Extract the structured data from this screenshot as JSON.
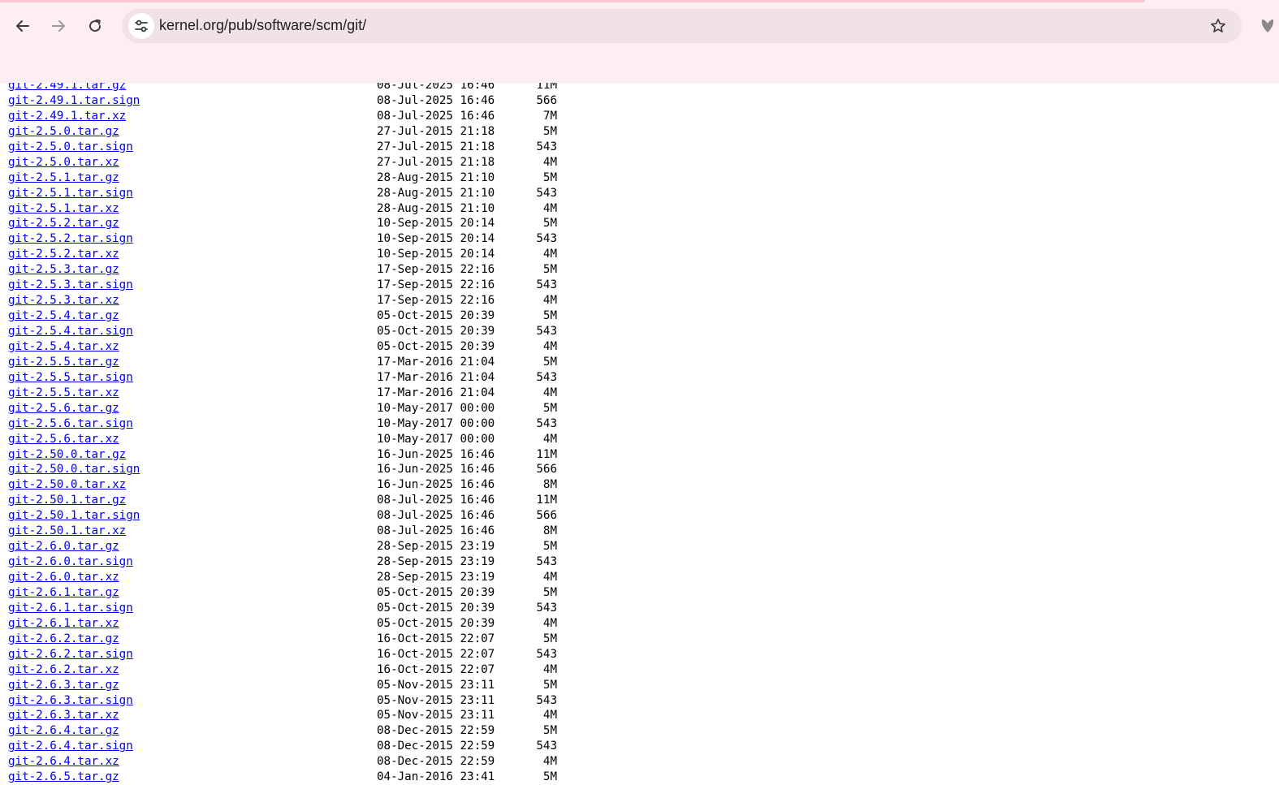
{
  "browser": {
    "url": "kernel.org/pub/software/scm/git/",
    "icons": {
      "back": "back-arrow-icon",
      "forward": "forward-arrow-icon",
      "reload": "reload-icon",
      "site_info": "tune-icon",
      "bookmark": "star-icon",
      "extension": "heart-icon"
    },
    "colors": {
      "toolbar": "#fdeff1",
      "omnibox": "#f1e2e5",
      "accent": "#f6c4cc"
    }
  },
  "listing": {
    "link_color": "#0000ee",
    "rows": [
      {
        "name": "git-2.49.1.tar.gz",
        "date": "08-Jul-2025 16:46",
        "size": "11M"
      },
      {
        "name": "git-2.49.1.tar.sign",
        "date": "08-Jul-2025 16:46",
        "size": "566"
      },
      {
        "name": "git-2.49.1.tar.xz",
        "date": "08-Jul-2025 16:46",
        "size": "7M"
      },
      {
        "name": "git-2.5.0.tar.gz",
        "date": "27-Jul-2015 21:18",
        "size": "5M"
      },
      {
        "name": "git-2.5.0.tar.sign",
        "date": "27-Jul-2015 21:18",
        "size": "543"
      },
      {
        "name": "git-2.5.0.tar.xz",
        "date": "27-Jul-2015 21:18",
        "size": "4M"
      },
      {
        "name": "git-2.5.1.tar.gz",
        "date": "28-Aug-2015 21:10",
        "size": "5M"
      },
      {
        "name": "git-2.5.1.tar.sign",
        "date": "28-Aug-2015 21:10",
        "size": "543"
      },
      {
        "name": "git-2.5.1.tar.xz",
        "date": "28-Aug-2015 21:10",
        "size": "4M"
      },
      {
        "name": "git-2.5.2.tar.gz",
        "date": "10-Sep-2015 20:14",
        "size": "5M"
      },
      {
        "name": "git-2.5.2.tar.sign",
        "date": "10-Sep-2015 20:14",
        "size": "543"
      },
      {
        "name": "git-2.5.2.tar.xz",
        "date": "10-Sep-2015 20:14",
        "size": "4M"
      },
      {
        "name": "git-2.5.3.tar.gz",
        "date": "17-Sep-2015 22:16",
        "size": "5M"
      },
      {
        "name": "git-2.5.3.tar.sign",
        "date": "17-Sep-2015 22:16",
        "size": "543"
      },
      {
        "name": "git-2.5.3.tar.xz",
        "date": "17-Sep-2015 22:16",
        "size": "4M"
      },
      {
        "name": "git-2.5.4.tar.gz",
        "date": "05-Oct-2015 20:39",
        "size": "5M"
      },
      {
        "name": "git-2.5.4.tar.sign",
        "date": "05-Oct-2015 20:39",
        "size": "543"
      },
      {
        "name": "git-2.5.4.tar.xz",
        "date": "05-Oct-2015 20:39",
        "size": "4M"
      },
      {
        "name": "git-2.5.5.tar.gz",
        "date": "17-Mar-2016 21:04",
        "size": "5M"
      },
      {
        "name": "git-2.5.5.tar.sign",
        "date": "17-Mar-2016 21:04",
        "size": "543"
      },
      {
        "name": "git-2.5.5.tar.xz",
        "date": "17-Mar-2016 21:04",
        "size": "4M"
      },
      {
        "name": "git-2.5.6.tar.gz",
        "date": "10-May-2017 00:00",
        "size": "5M"
      },
      {
        "name": "git-2.5.6.tar.sign",
        "date": "10-May-2017 00:00",
        "size": "543"
      },
      {
        "name": "git-2.5.6.tar.xz",
        "date": "10-May-2017 00:00",
        "size": "4M"
      },
      {
        "name": "git-2.50.0.tar.gz",
        "date": "16-Jun-2025 16:46",
        "size": "11M"
      },
      {
        "name": "git-2.50.0.tar.sign",
        "date": "16-Jun-2025 16:46",
        "size": "566"
      },
      {
        "name": "git-2.50.0.tar.xz",
        "date": "16-Jun-2025 16:46",
        "size": "8M"
      },
      {
        "name": "git-2.50.1.tar.gz",
        "date": "08-Jul-2025 16:46",
        "size": "11M"
      },
      {
        "name": "git-2.50.1.tar.sign",
        "date": "08-Jul-2025 16:46",
        "size": "566"
      },
      {
        "name": "git-2.50.1.tar.xz",
        "date": "08-Jul-2025 16:46",
        "size": "8M"
      },
      {
        "name": "git-2.6.0.tar.gz",
        "date": "28-Sep-2015 23:19",
        "size": "5M"
      },
      {
        "name": "git-2.6.0.tar.sign",
        "date": "28-Sep-2015 23:19",
        "size": "543"
      },
      {
        "name": "git-2.6.0.tar.xz",
        "date": "28-Sep-2015 23:19",
        "size": "4M"
      },
      {
        "name": "git-2.6.1.tar.gz",
        "date": "05-Oct-2015 20:39",
        "size": "5M"
      },
      {
        "name": "git-2.6.1.tar.sign",
        "date": "05-Oct-2015 20:39",
        "size": "543"
      },
      {
        "name": "git-2.6.1.tar.xz",
        "date": "05-Oct-2015 20:39",
        "size": "4M"
      },
      {
        "name": "git-2.6.2.tar.gz",
        "date": "16-Oct-2015 22:07",
        "size": "5M"
      },
      {
        "name": "git-2.6.2.tar.sign",
        "date": "16-Oct-2015 22:07",
        "size": "543"
      },
      {
        "name": "git-2.6.2.tar.xz",
        "date": "16-Oct-2015 22:07",
        "size": "4M"
      },
      {
        "name": "git-2.6.3.tar.gz",
        "date": "05-Nov-2015 23:11",
        "size": "5M"
      },
      {
        "name": "git-2.6.3.tar.sign",
        "date": "05-Nov-2015 23:11",
        "size": "543"
      },
      {
        "name": "git-2.6.3.tar.xz",
        "date": "05-Nov-2015 23:11",
        "size": "4M"
      },
      {
        "name": "git-2.6.4.tar.gz",
        "date": "08-Dec-2015 22:59",
        "size": "5M"
      },
      {
        "name": "git-2.6.4.tar.sign",
        "date": "08-Dec-2015 22:59",
        "size": "543"
      },
      {
        "name": "git-2.6.4.tar.xz",
        "date": "08-Dec-2015 22:59",
        "size": "4M"
      },
      {
        "name": "git-2.6.5.tar.gz",
        "date": "04-Jan-2016 23:41",
        "size": "5M"
      }
    ]
  }
}
